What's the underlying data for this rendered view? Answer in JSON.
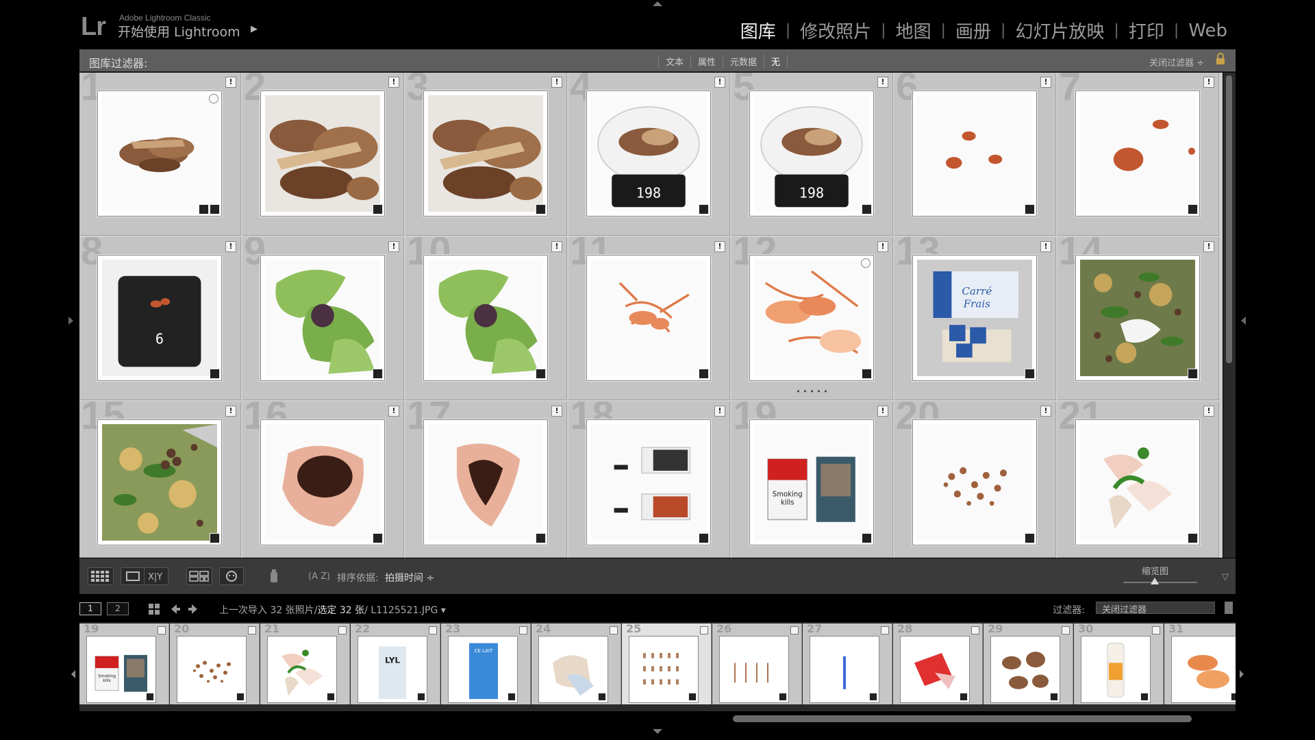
{
  "identity": {
    "logo": "Lr",
    "app_name": "Adobe Lightroom Classic",
    "title": "开始使用 Lightroom",
    "arrow": "▶"
  },
  "modules": [
    "图库",
    "修改照片",
    "地图",
    "画册",
    "幻灯片放映",
    "打印",
    "Web"
  ],
  "active_module": "图库",
  "filter_bar": {
    "label": "图库过滤器:",
    "tabs": [
      "文本",
      "属性",
      "元数据",
      "无"
    ],
    "active_tab": "无",
    "close_label": "关闭过滤器 ÷"
  },
  "grid": {
    "cells": [
      {
        "n": "1",
        "flag": "!"
      },
      {
        "n": "2",
        "flag": "!"
      },
      {
        "n": "3",
        "flag": "!"
      },
      {
        "n": "4",
        "flag": "!"
      },
      {
        "n": "5",
        "flag": "!"
      },
      {
        "n": "6",
        "flag": "!"
      },
      {
        "n": "7",
        "flag": "!"
      },
      {
        "n": "8",
        "flag": "!"
      },
      {
        "n": "9",
        "flag": "!"
      },
      {
        "n": "10",
        "flag": "!"
      },
      {
        "n": "11",
        "flag": "!"
      },
      {
        "n": "12",
        "flag": "!"
      },
      {
        "n": "13",
        "flag": "!"
      },
      {
        "n": "14",
        "flag": "!"
      },
      {
        "n": "15",
        "flag": "!"
      },
      {
        "n": "16",
        "flag": "!"
      },
      {
        "n": "17",
        "flag": "!"
      },
      {
        "n": "18",
        "flag": "!"
      },
      {
        "n": "19",
        "flag": "!"
      },
      {
        "n": "20",
        "flag": "!"
      },
      {
        "n": "21",
        "flag": "!"
      }
    ],
    "scale_readings": [
      "198",
      "198",
      "6"
    ],
    "box_text": "Carré Frais",
    "cigarette_text": "Smoking kills",
    "stack_dots": "• • • • •"
  },
  "toolbar": {
    "sort_label": "排序依据:",
    "sort_value": "拍摄时间 ÷",
    "thumbnail_label": "缩览图"
  },
  "filmstrip_header": {
    "page1": "1",
    "page2": "2",
    "info_prefix": "上一次导入   32 张照片/",
    "selected": "选定 32 张",
    "file": "/ L1125521.JPG ▾",
    "filter_label": "过滤器:",
    "filter_value": "关闭过滤器"
  },
  "filmstrip": {
    "numbers": [
      "19",
      "20",
      "21",
      "22",
      "23",
      "24",
      "25",
      "26",
      "27",
      "28",
      "29",
      "30",
      "31"
    ],
    "selected_index": 6
  },
  "colors": {
    "background": "#000000",
    "panel": "#5e5e5e",
    "grid_bg": "#cfcfcf",
    "cell_bg": "#c4c4c4",
    "active_text": "#f0f0f0"
  }
}
